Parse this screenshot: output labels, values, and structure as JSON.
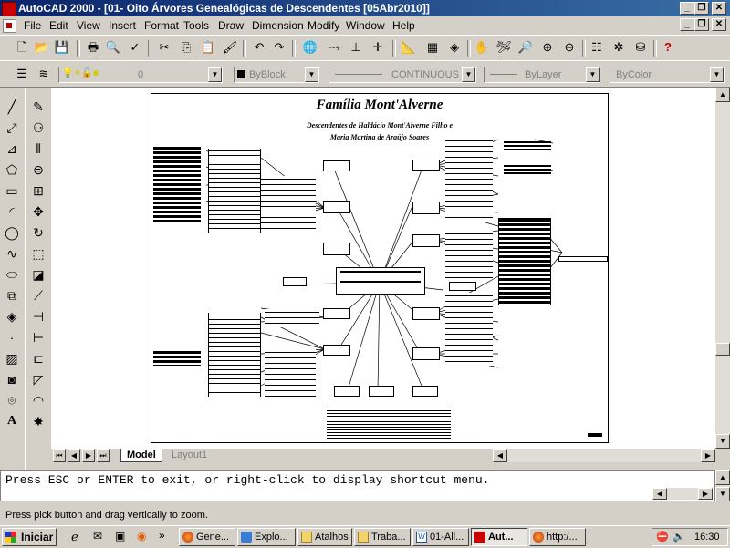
{
  "window": {
    "title": "AutoCAD 2000 - [01- Oito Árvores  Genealógicas de Descendentes  [05Abr2010]]",
    "buttons": [
      "_",
      "❐",
      "✕"
    ]
  },
  "menu": {
    "items": [
      "File",
      "Edit",
      "View",
      "Insert",
      "Format",
      "Tools",
      "Draw",
      "Dimension",
      "Modify",
      "Window",
      "Help"
    ],
    "doc_buttons": [
      "_",
      "❐",
      "✕"
    ]
  },
  "properties": {
    "layer_value": "0",
    "color_value": "ByBlock",
    "linetype_value": "CONTINUOUS",
    "lineweight_value": "ByLayer",
    "plotstyle_value": "ByColor"
  },
  "drawing": {
    "title": "Família Mont'Alverne",
    "subtitle_line1": "Descendentes de Haldácio Mont'Alverne Filho e",
    "subtitle_line2": "Maria Martina de Araújo Soares"
  },
  "layout_tabs": [
    "Model",
    "Layout1"
  ],
  "command": {
    "prompt": "Press ESC or ENTER to exit, or right-click to display shortcut menu."
  },
  "status": {
    "text": "Press pick button and drag vertically to zoom."
  },
  "taskbar": {
    "start_label": "Iniciar",
    "tasks": [
      {
        "label": "Gene...",
        "icon": "firefox-icon"
      },
      {
        "label": "Explo...",
        "icon": "explorer-icon"
      },
      {
        "label": "Atalhos",
        "icon": "folder-icon"
      },
      {
        "label": "Traba...",
        "icon": "folder-icon"
      },
      {
        "label": "01-All...",
        "icon": "word-icon"
      },
      {
        "label": "Aut...",
        "icon": "autocad-icon"
      },
      {
        "label": "http:/...",
        "icon": "firefox-icon"
      }
    ],
    "clock": "16:30"
  },
  "colors": {
    "titlebar_start": "#0a246a",
    "titlebar_end": "#3a6ea5",
    "chrome": "#d4d0c8"
  }
}
